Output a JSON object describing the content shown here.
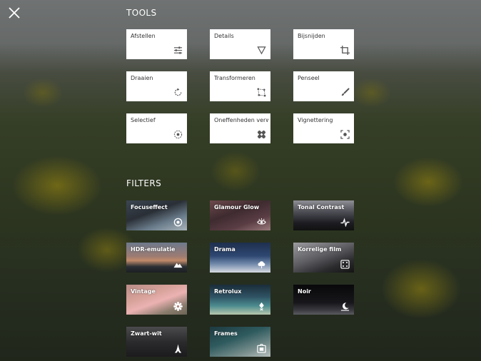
{
  "tools_title": "TOOLS",
  "filters_title": "FILTERS",
  "tools": [
    {
      "label": "Afstellen",
      "icon": "sliders-icon"
    },
    {
      "label": "Details",
      "icon": "triangle-down-icon"
    },
    {
      "label": "Bijsnijden",
      "icon": "crop-icon"
    },
    {
      "label": "Draaien",
      "icon": "rotate-icon"
    },
    {
      "label": "Transformeren",
      "icon": "transform-icon"
    },
    {
      "label": "Penseel",
      "icon": "brush-icon"
    },
    {
      "label": "Selectief",
      "icon": "selective-target-icon"
    },
    {
      "label": "Oneffenheden verw...",
      "icon": "bandage-icon"
    },
    {
      "label": "Vignettering",
      "icon": "vignette-icon"
    }
  ],
  "filters": [
    {
      "label": "Focuseffect",
      "icon": "focus-circle-icon"
    },
    {
      "label": "Glamour Glow",
      "icon": "eye-icon"
    },
    {
      "label": "Tonal Contrast",
      "icon": "contrast-wave-icon"
    },
    {
      "label": "HDR-emulatie",
      "icon": "mountain-icon"
    },
    {
      "label": "Drama",
      "icon": "cloud-icon"
    },
    {
      "label": "Korrelige film",
      "icon": "grain-dice-icon"
    },
    {
      "label": "Vintage",
      "icon": "gear-flower-icon"
    },
    {
      "label": "Retrolux",
      "icon": "retrolux-icon"
    },
    {
      "label": "Noir",
      "icon": "moon-icon"
    },
    {
      "label": "Zwart-wit",
      "icon": "eiffel-tower-icon"
    },
    {
      "label": "Frames",
      "icon": "frame-icon"
    }
  ]
}
